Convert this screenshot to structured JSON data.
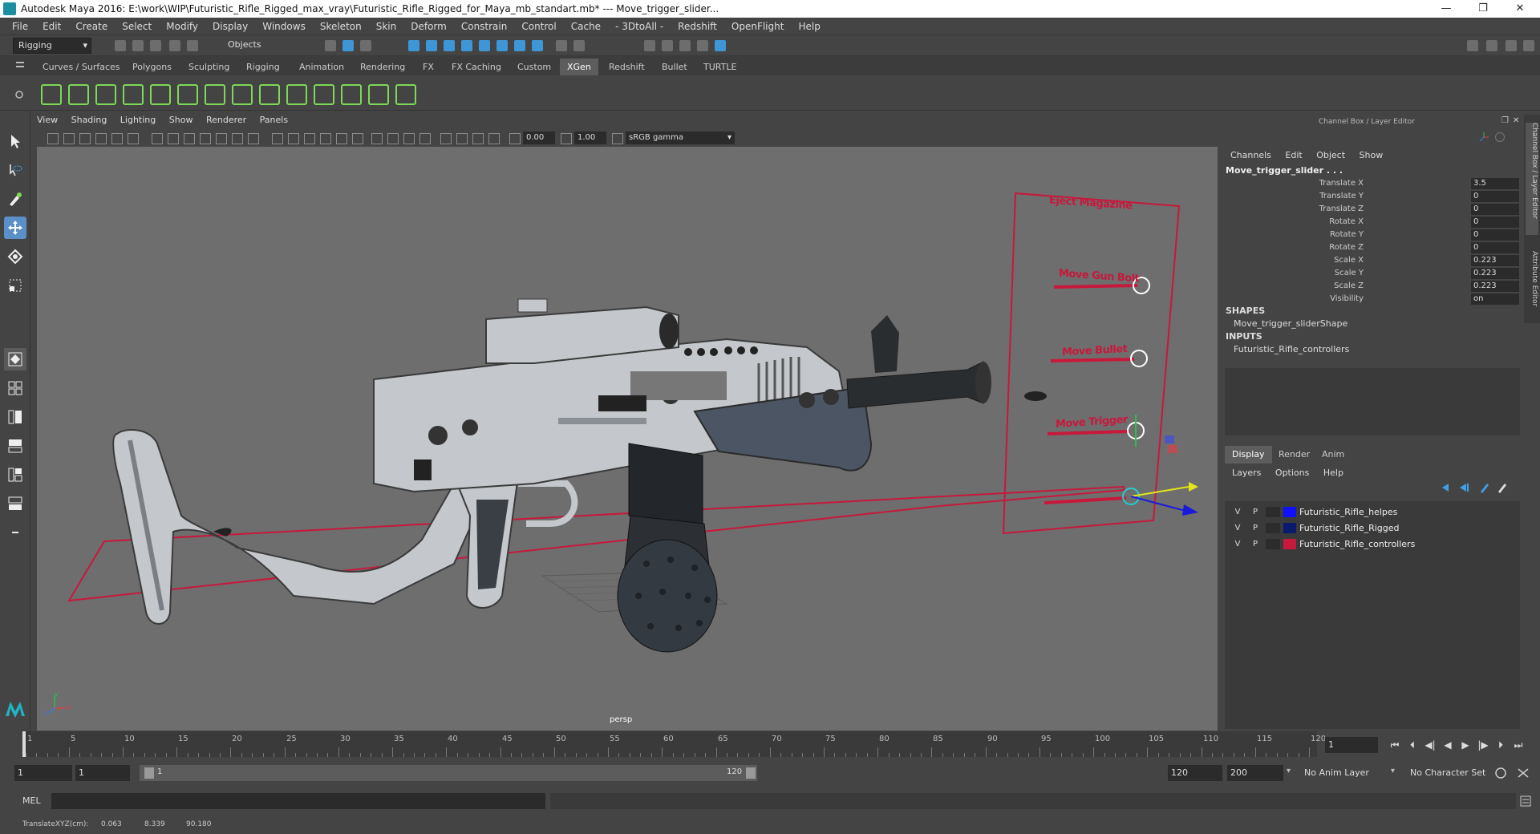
{
  "window": {
    "title": "Autodesk Maya 2016: E:\\work\\WIP\\Futuristic_Rifle_Rigged_max_vray\\Futuristic_Rifle_Rigged_for_Maya_mb_standart.mb*   ---   Move_trigger_slider...",
    "minimize": "—",
    "restore": "❐",
    "close": "✕"
  },
  "menubar": {
    "items": [
      "File",
      "Edit",
      "Create",
      "Select",
      "Modify",
      "Display",
      "Windows",
      "Skeleton",
      "Skin",
      "Deform",
      "Constrain",
      "Control",
      "Cache",
      "- 3DtoAll -",
      "Redshift",
      "OpenFlight",
      "Help"
    ]
  },
  "statusline": {
    "mode": "Rigging",
    "selection_mode": "Objects"
  },
  "shelf": {
    "tabs": [
      "Curves / Surfaces",
      "Polygons",
      "Sculpting",
      "Rigging",
      "Animation",
      "Rendering",
      "FX",
      "FX Caching",
      "Custom",
      "XGen",
      "Redshift",
      "Bullet",
      "TURTLE"
    ],
    "active_tab": "XGen"
  },
  "viewport": {
    "menu": [
      "View",
      "Shading",
      "Lighting",
      "Show",
      "Renderer",
      "Panels"
    ],
    "exposure": "0.00",
    "gamma": "1.00",
    "color_space": "sRGB gamma",
    "camera_label": "persp",
    "controls": [
      {
        "label": "Eject Magazine",
        "color": "#c8183c"
      },
      {
        "label": "Move Gun Bolt",
        "color": "#c8183c"
      },
      {
        "label": "Move Bullet",
        "color": "#c8183c"
      },
      {
        "label": "Move Trigger",
        "color": "#c8183c"
      }
    ],
    "axis_labels": {
      "x": "x",
      "y": "y",
      "z": "z"
    }
  },
  "channelbox": {
    "title": "Channel Box / Layer Editor",
    "menu": [
      "Channels",
      "Edit",
      "Object",
      "Show"
    ],
    "node": "Move_trigger_slider . . .",
    "attributes": [
      {
        "label": "Translate X",
        "value": "3.5"
      },
      {
        "label": "Translate Y",
        "value": "0"
      },
      {
        "label": "Translate Z",
        "value": "0"
      },
      {
        "label": "Rotate X",
        "value": "0"
      },
      {
        "label": "Rotate Y",
        "value": "0"
      },
      {
        "label": "Rotate Z",
        "value": "0"
      },
      {
        "label": "Scale X",
        "value": "0.223"
      },
      {
        "label": "Scale Y",
        "value": "0.223"
      },
      {
        "label": "Scale Z",
        "value": "0.223"
      },
      {
        "label": "Visibility",
        "value": "on"
      }
    ],
    "shapes_header": "SHAPES",
    "shape": "Move_trigger_sliderShape",
    "inputs_header": "INPUTS",
    "input": "Futuristic_Rifle_controllers"
  },
  "layer_editor": {
    "tabs": [
      "Display",
      "Render",
      "Anim"
    ],
    "active_tab": "Display",
    "menu": [
      "Layers",
      "Options",
      "Help"
    ],
    "layers": [
      {
        "v": "V",
        "p": "P",
        "name": "Futuristic_Rifle_helpes",
        "color": "#1010ff"
      },
      {
        "v": "V",
        "p": "P",
        "name": "Futuristic_Rifle_Rigged",
        "color": "#0a1a6e"
      },
      {
        "v": "V",
        "p": "P",
        "name": "Futuristic_Rifle_controllers",
        "color": "#c8183c"
      }
    ]
  },
  "sidetabs": {
    "channel_box": "Channel Box / Layer Editor",
    "attribute_editor": "Attribute Editor"
  },
  "timeslider": {
    "ticks": [
      "1",
      "5",
      "10",
      "15",
      "20",
      "25",
      "30",
      "35",
      "40",
      "45",
      "50",
      "55",
      "60",
      "65",
      "70",
      "75",
      "80",
      "85",
      "90",
      "95",
      "100",
      "105",
      "110",
      "115",
      "120"
    ],
    "current_frame": "1"
  },
  "rangeslider": {
    "start": "1",
    "range_start": "1",
    "range_inner_start": "1",
    "range_inner_end": "120",
    "range_end": "120",
    "end": "200",
    "anim_layer": "No Anim Layer",
    "character_set": "No Character Set"
  },
  "cmdline": {
    "label": "MEL"
  },
  "helpline": {
    "label": "TranslateXYZ(cm):",
    "x": "0.063",
    "y": "8.339",
    "z": "90.180"
  }
}
